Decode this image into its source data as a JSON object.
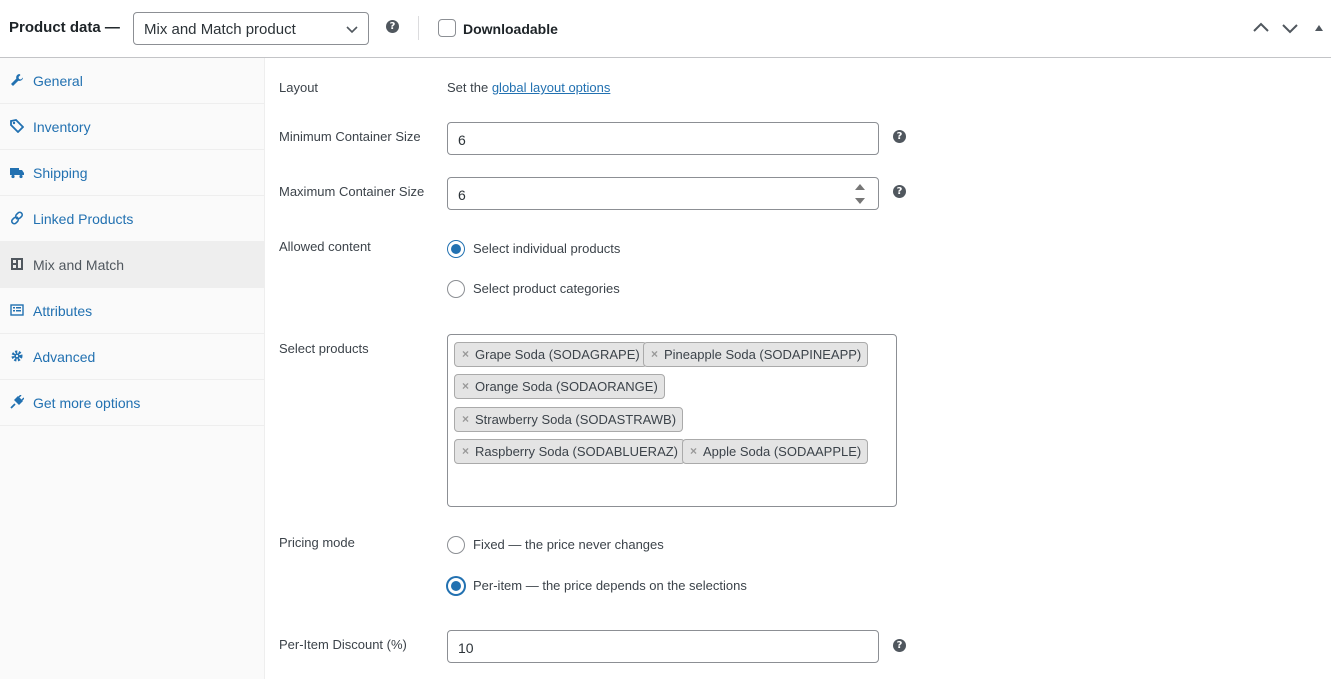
{
  "header": {
    "title": "Product data —",
    "product_type": "Mix and Match product",
    "downloadable_label": "Downloadable",
    "downloadable_checked": false
  },
  "sidebar": {
    "items": [
      {
        "label": "General",
        "icon": "wrench-icon",
        "active": false
      },
      {
        "label": "Inventory",
        "icon": "tag-icon",
        "active": false
      },
      {
        "label": "Shipping",
        "icon": "truck-icon",
        "active": false
      },
      {
        "label": "Linked Products",
        "icon": "link-icon",
        "active": false
      },
      {
        "label": "Mix and Match",
        "icon": "grid-icon",
        "active": true
      },
      {
        "label": "Attributes",
        "icon": "list-icon",
        "active": false
      },
      {
        "label": "Advanced",
        "icon": "gear-icon",
        "active": false
      },
      {
        "label": "Get more options",
        "icon": "plugin-icon",
        "active": false
      }
    ]
  },
  "main": {
    "layout": {
      "label": "Layout",
      "text_prefix": "Set the",
      "link_text": "global layout options"
    },
    "min_size": {
      "label": "Minimum Container Size",
      "value": "6"
    },
    "max_size": {
      "label": "Maximum Container Size",
      "value": "6"
    },
    "allowed_content": {
      "label": "Allowed content",
      "options": [
        {
          "label": "Select individual products",
          "checked": true
        },
        {
          "label": "Select product categories",
          "checked": false
        }
      ]
    },
    "select_products": {
      "label": "Select products",
      "chips": [
        "Grape Soda (SODAGRAPE)",
        "Pineapple Soda (SODAPINEAPP)",
        "Orange Soda (SODAORANGE)",
        "Strawberry Soda (SODASTRAWB)",
        "Raspberry Soda (SODABLUERAZ)",
        "Apple Soda (SODAAPPLE)"
      ]
    },
    "pricing_mode": {
      "label": "Pricing mode",
      "options": [
        {
          "label": "Fixed — the price never changes",
          "checked": false
        },
        {
          "label": "Per-item — the price depends on the selections",
          "checked": true
        }
      ]
    },
    "discount": {
      "label": "Per-Item Discount (%)",
      "value": "10"
    }
  },
  "colors": {
    "accent": "#2271b1",
    "text": "#3c434a",
    "border": "#8c8f94"
  }
}
